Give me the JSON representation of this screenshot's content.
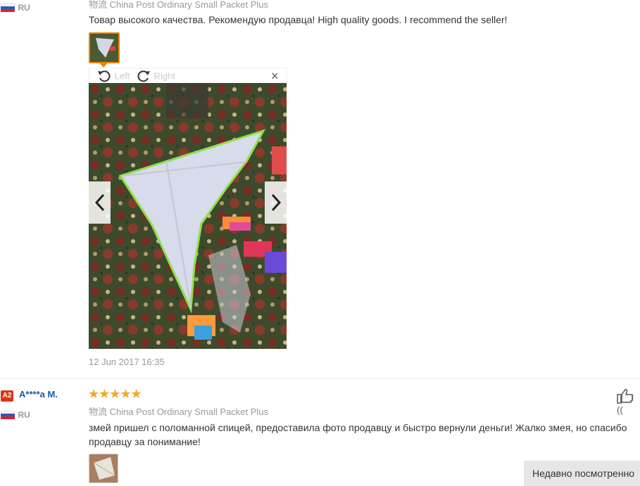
{
  "review1": {
    "country": "RU",
    "shipping": "物流 China Post Ordinary Small Packet Plus",
    "text": "Товар высокого качества. Рекомендую продавца! High quality goods. I recommend the seller!",
    "viewer": {
      "left_label": "Left",
      "right_label": "Right",
      "close": "×"
    },
    "date": "12 Jun 2017 16:35"
  },
  "review2": {
    "badge": "A2",
    "username": "A****a M.",
    "stars": "★★★★★",
    "country": "RU",
    "shipping": "物流 China Post Ordinary Small Packet Plus",
    "text_line1": "змей пришел с поломанной спицей, предоставила фото продавцу и быстро вернули деньги! Жалко змея, но спасибо",
    "text_line2": "продавцу за понимание!",
    "helpful": "(("
  },
  "recently_viewed": "Недавно посмотренно"
}
